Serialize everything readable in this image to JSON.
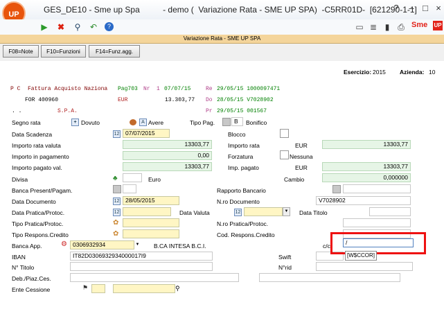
{
  "app": {
    "logo": "UP",
    "title": "GES_DE10 - Sme up Spa          - demo (  Variazione Rata - SME UP SPA)  -C5RR01D-  [621290-1-1]",
    "window_controls": [
      "?",
      "–",
      "□",
      "×"
    ],
    "brand": "Sme",
    "brand_up": "UP"
  },
  "header": {
    "bar_title": "Variazione Rata -  SME UP SPA"
  },
  "fkeys": [
    "F08=Note",
    "F10=Funzioni",
    "F14=Funz.agg."
  ],
  "esercizio": {
    "label": "Esercizio:",
    "value": "2015"
  },
  "azienda": {
    "label": "Azienda:",
    "value": "10"
  },
  "doc": {
    "l1": {
      "pc": "P C",
      "desc": "Fattura Acquisto Naziona",
      "pag": "Pag703",
      "nr_lbl": "Nr",
      "nr": "1",
      "date": "07/07/15",
      "re_lbl": "Re",
      "re": "29/05/15 1000097471"
    },
    "l2": {
      "for": "FOR 400960",
      "cur": "EUR",
      "amount": "13.303,77",
      "do_lbl": "Do",
      "do": "28/05/15 V7028902"
    },
    "l3": {
      "dots": ". .",
      "spa": "S.P.A.",
      "pr_lbl": "Pr",
      "pr": "29/05/15 001567"
    }
  },
  "form": {
    "segno_rata": "Segno rata",
    "dovuto_sign": "+",
    "dovuto": "Dovuto",
    "avere_sign": "A",
    "avere": "Avere",
    "tipo_pag": "Tipo Pag.",
    "tipo_pag_val": "B",
    "bonifico": "Bonifico",
    "data_scadenza": "Data Scadenza",
    "data_scadenza_val": "07/07/2015",
    "blocco": "Blocco",
    "importo_rata_valuta": "Importo rata valuta",
    "importo_rata_valuta_val": "13303,77",
    "importo_rata": "Importo rata",
    "importo_rata_cur": "EUR",
    "importo_rata_val": "13303,77",
    "importo_pagamento": "Importo in pagamento",
    "importo_pagamento_val": "0,00",
    "forzatura": "Forzatura",
    "nessuna": "Nessuna",
    "importo_pagato_val": "Importo pagato val.",
    "importo_pagato_val_val": "13303,77",
    "imp_pagato": "Imp. pagato",
    "imp_pagato_cur": "EUR",
    "imp_pagato_val": "13303,77",
    "divisa": "Divisa",
    "euro": "Euro",
    "cambio": "Cambio",
    "cambio_val": "0,000000",
    "banca_present": "Banca Present/Pagam.",
    "rapporto_bancario": "Rapporto Bancario",
    "data_documento": "Data Documento",
    "data_documento_val": "28/05/2015",
    "nro_documento": "N.ro Documento",
    "nro_documento_val": "V7028902",
    "data_pratica": "Data Pratica/Protoc.",
    "data_valuta": "Data Valuta",
    "data_titolo": "Data Titolo",
    "tipo_pratica": "Tipo Pratica/Protoc.",
    "nro_pratica": "N.ro Pratica/Protoc.",
    "tipo_respons": "Tipo Respons.Credito",
    "cod_respons": "Cod. Respons.Credito",
    "banca_app": "Banca App.",
    "banca_app_val": "0306932934",
    "banca_app_name": "B.CA INTESA B.C.I.",
    "cc": "c/c",
    "cc_val": "/",
    "tooltip": "[W$CCOR]",
    "iban": "IBAN",
    "iban_val": "IT82D0306932934000017I9",
    "swift": "Swift",
    "n_titolo": "N° Titolo",
    "n_rid": "N°rid",
    "deb_piaz": "Deb./Piaz.Ces.",
    "ente_cessione": "Ente Cessione"
  }
}
